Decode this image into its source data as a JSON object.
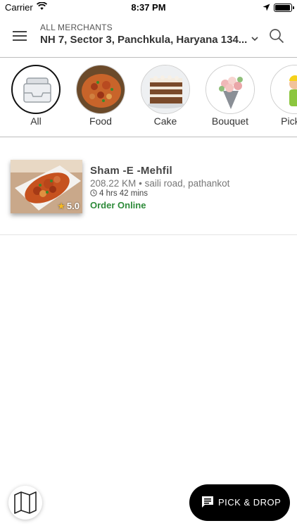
{
  "status_bar": {
    "carrier": "Carrier",
    "time": "8:37 PM"
  },
  "header": {
    "label": "ALL MERCHANTS",
    "address": "NH 7, Sector 3, Panchkula, Haryana 134..."
  },
  "categories": [
    {
      "label": "All",
      "icon": "inbox-tray-icon",
      "active": true
    },
    {
      "label": "Food",
      "icon": "food-dish-image"
    },
    {
      "label": "Cake",
      "icon": "cake-image"
    },
    {
      "label": "Bouquet",
      "icon": "bouquet-image"
    },
    {
      "label": "Pick &",
      "icon": "delivery-man-image"
    }
  ],
  "merchants": [
    {
      "name": "Sham -E -Mehfil",
      "distance": "208.22 KM",
      "separator": "•",
      "location": "saili road, pathankot",
      "time": "4 hrs 42 mins",
      "status": "Order Online",
      "rating": "5.0"
    }
  ],
  "bottom": {
    "pick_drop_label": "PICK & DROP"
  },
  "colors": {
    "accent_green": "#2e8b3a",
    "star": "#f5b921",
    "fab_bg": "#000000"
  }
}
